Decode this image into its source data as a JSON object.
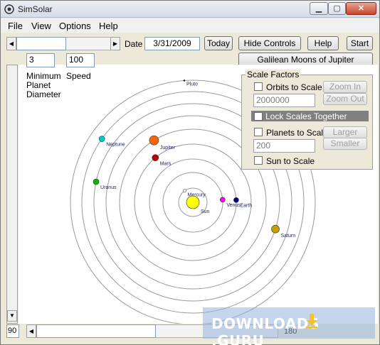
{
  "window": {
    "title": "SimSolar"
  },
  "menu": [
    "File",
    "View",
    "Options",
    "Help"
  ],
  "toolbar": {
    "date_label": "Date",
    "date_value": "3/31/2009",
    "today": "Today",
    "hide_controls": "Hide Controls",
    "help": "Help",
    "start": "Start",
    "galilean": "Galilean Moons of Jupiter Simulator"
  },
  "controls": {
    "min_diameter_value": "3",
    "speed_value": "100",
    "min_diameter_label": [
      "Minimum",
      "Planet",
      "Diameter"
    ],
    "speed_label": "Speed"
  },
  "scale": {
    "title": "Scale Factors",
    "orbits_label": "Orbits to Scale",
    "orbits_value": "2000000",
    "zoom_in": "Zoom In",
    "zoom_out": "Zoom Out",
    "lock_label": "Lock  Scales  Together",
    "planets_label": "Planets to Scale",
    "planets_value": "200",
    "larger": "Larger",
    "smaller": "Smaller",
    "sun_label": "Sun to Scale"
  },
  "bottom": {
    "left_value": "90",
    "right_value": "180"
  },
  "planets": [
    {
      "name": "Sun",
      "color": "#ffff00",
      "orbit": 0,
      "angle": 0,
      "size": 9
    },
    {
      "name": "Mercury",
      "color": "#ffffff",
      "orbit": 20,
      "angle": 125,
      "size": 2
    },
    {
      "name": "Venus",
      "color": "#ff00ff",
      "orbit": 42,
      "angle": 5,
      "size": 3.5
    },
    {
      "name": "Earth",
      "color": "#00008b",
      "orbit": 61,
      "angle": 3,
      "size": 3.5
    },
    {
      "name": "Mars",
      "color": "#c00000",
      "orbit": 82,
      "angle": 130,
      "size": 4.5
    },
    {
      "name": "Jupiter",
      "color": "#ff6600",
      "orbit": 103,
      "angle": 122,
      "size": 6.5
    },
    {
      "name": "Saturn",
      "color": "#c8a000",
      "orbit": 122,
      "angle": -18,
      "size": 5.5
    },
    {
      "name": "Uranus",
      "color": "#00bb00",
      "orbit": 139,
      "angle": 168,
      "size": 4
    },
    {
      "name": "Neptune",
      "color": "#00cccc",
      "orbit": 156,
      "angle": 145,
      "size": 4
    },
    {
      "name": "Pluto",
      "color": "#000000",
      "orbit": 172,
      "angle": 94,
      "size": 1
    }
  ],
  "watermark": {
    "text": "DOWNLOADS",
    "suffix": ".GURU"
  }
}
